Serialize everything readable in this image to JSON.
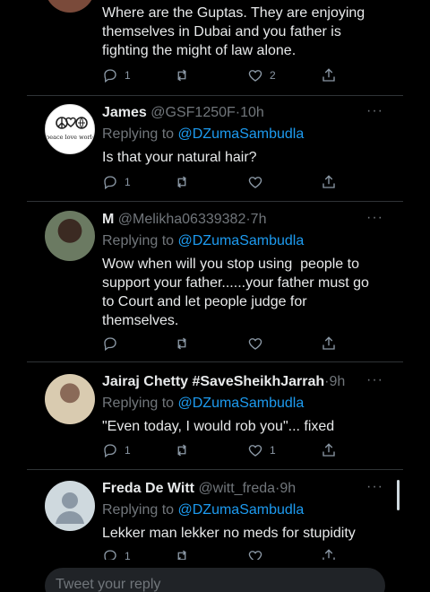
{
  "tweets": [
    {
      "name": "",
      "handle": "",
      "time": "",
      "replying_prefix": "",
      "mention": "",
      "text_lines": [
        "Where are the Guptas. They are enjoying",
        "themselves in Dubai and you father is",
        "fighting the might of law alone."
      ],
      "replies": "1",
      "retweets": "",
      "likes": "2",
      "avatar_color": "#7a4a3a"
    },
    {
      "name": "James",
      "handle": "@GSF1250F",
      "time": "10h",
      "replying_prefix": "Replying to",
      "mention": "@DZumaSambudla",
      "text_lines": [
        "Is that your natural hair?"
      ],
      "replies": "1",
      "retweets": "",
      "likes": "",
      "avatar_caption": "peace love world",
      "avatar_color": "#ffffff"
    },
    {
      "name": "M",
      "handle": "@Melikha06339382",
      "time": "7h",
      "replying_prefix": "Replying to",
      "mention": "@DZumaSambudla",
      "text_lines": [
        "Wow when will you stop using  people to",
        "support your father......your father must go",
        "to Court and let people judge for",
        "themselves."
      ],
      "replies": "",
      "retweets": "",
      "likes": "",
      "avatar_color": "#4b5a4a"
    },
    {
      "name": "Jairaj Chetty #SaveSheikhJarrah",
      "handle": "",
      "time": "9h",
      "replying_prefix": "Replying to",
      "mention": "@DZumaSambudla",
      "text_lines": [
        "\"Even today, I would rob you\"... fixed"
      ],
      "replies": "1",
      "retweets": "",
      "likes": "1",
      "avatar_color": "#c9b79a"
    },
    {
      "name": "Freda De Witt",
      "handle": "@witt_freda",
      "time": "9h",
      "replying_prefix": "Replying to",
      "mention": "@DZumaSambudla",
      "text_lines": [
        "Lekker man lekker no meds for stupidity"
      ],
      "replies": "1",
      "retweets": "",
      "likes": "",
      "avatar_color": "#cfd9de"
    }
  ],
  "dot": "·",
  "more_label": "···",
  "reply_placeholder": "Tweet your reply",
  "icons": [
    "reply-icon",
    "retweet-icon",
    "like-icon",
    "share-icon"
  ],
  "colors": {
    "background": "#000000",
    "text": "#e7e9ea",
    "muted": "#71767b",
    "accent": "#1d9bf0"
  }
}
